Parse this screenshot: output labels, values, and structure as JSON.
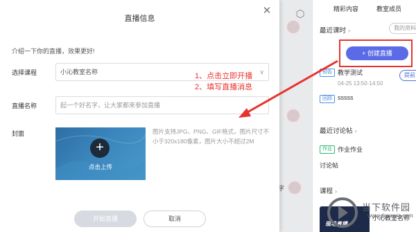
{
  "modal": {
    "title": "直播信息",
    "intro": "介绍一下你的直播，效果更好!",
    "course_label": "选择课程",
    "course_value": "小沁教室名称",
    "name_label": "直播名称",
    "name_placeholder": "起一个好名字，让大家都来参加直播",
    "cover_label": "封面",
    "cover_upload": "点击上传",
    "cover_hint": "图片支持JPG、PNG、GIF格式，图片尺寸不小于320x180像素，图片大小不超过2M",
    "start_button": "开始直播",
    "cancel_button": "取消"
  },
  "annotations": {
    "step1": "1、点击立即开播",
    "step2": "2、填写直播消息"
  },
  "right_panel": {
    "tabs": [
      "精彩内容",
      "教室成员"
    ],
    "recent_lessons": "最近课时",
    "my_info": "我的资料",
    "create_live": "+ 创建直播",
    "item1_tag": "预告",
    "item1_title": "教学测试",
    "item1_time": "04-25 13:50-14:50",
    "item1_btn": "提前",
    "item2_tag": "回顾",
    "item2_title": "sssss",
    "recent_discussions": "最近讨论帖",
    "disc_tag": "作业",
    "disc_title": "作业作业",
    "disc_sub": "讨论帖",
    "course_section": "课程",
    "course_thumb_text": "现场直播",
    "course_name": "小沁教室名称"
  },
  "background": {
    "side_text": "字"
  },
  "watermark": {
    "name": "当下软件园",
    "url": "www.downxia.com"
  }
}
